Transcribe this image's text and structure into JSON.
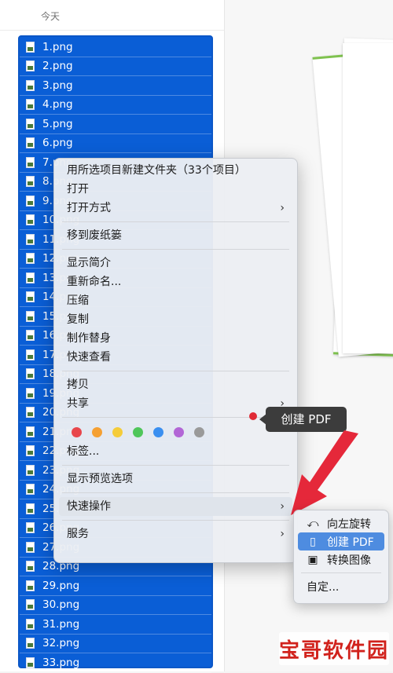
{
  "finder": {
    "section_header": "今天",
    "files": [
      "1.png",
      "2.png",
      "3.png",
      "4.png",
      "5.png",
      "6.png",
      "7.png",
      "8.png",
      "9.png",
      "10.png",
      "11.png",
      "12.png",
      "13.png",
      "14.png",
      "15.png",
      "16.png",
      "17.png",
      "18.png",
      "19.png",
      "20.png",
      "21.png",
      "22.png",
      "23.png",
      "24.png",
      "25.png",
      "26.png",
      "27.png",
      "28.png",
      "29.png",
      "30.png",
      "31.png",
      "32.png",
      "33.png"
    ]
  },
  "context_menu": {
    "new_folder": "用所选项目新建文件夹（33个项目）",
    "open": "打开",
    "open_with": "打开方式",
    "move_to_trash": "移到废纸篓",
    "get_info": "显示简介",
    "rename": "重新命名...",
    "compress": "压缩",
    "duplicate": "复制",
    "make_alias": "制作替身",
    "quick_look": "快速查看",
    "copy": "拷贝",
    "share": "共享",
    "tag_colors": [
      "#e8464b",
      "#f5a032",
      "#f5cc3a",
      "#4fc65a",
      "#3a8ff0",
      "#b266d6",
      "#9a9a9a"
    ],
    "tags": "标签...",
    "show_preview_options": "显示预览选项",
    "quick_actions": "快速操作",
    "services": "服务",
    "chevron": "›"
  },
  "submenu": {
    "rotate_left": "向左旋转",
    "create_pdf": "创建 PDF",
    "convert_image": "转换图像",
    "customize": "自定..."
  },
  "tooltip": {
    "text": "创建 PDF"
  },
  "watermark": {
    "text": "宝哥软件园"
  },
  "colors": {
    "selection": "#0a5ed6",
    "arrow": "#e5283a",
    "active_submenu": "#4e8ce0"
  }
}
